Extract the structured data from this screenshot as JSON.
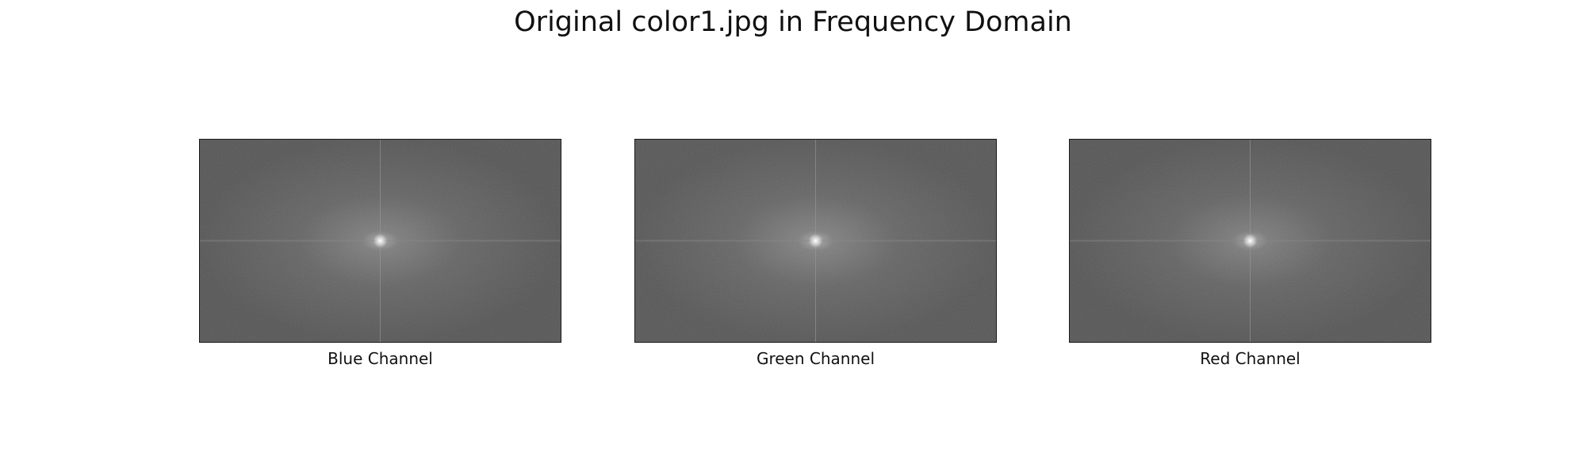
{
  "figure": {
    "title": "Original color1.jpg in Frequency Domain",
    "panels": [
      {
        "caption": "Blue Channel"
      },
      {
        "caption": "Green Channel"
      },
      {
        "caption": "Red Channel"
      }
    ]
  }
}
